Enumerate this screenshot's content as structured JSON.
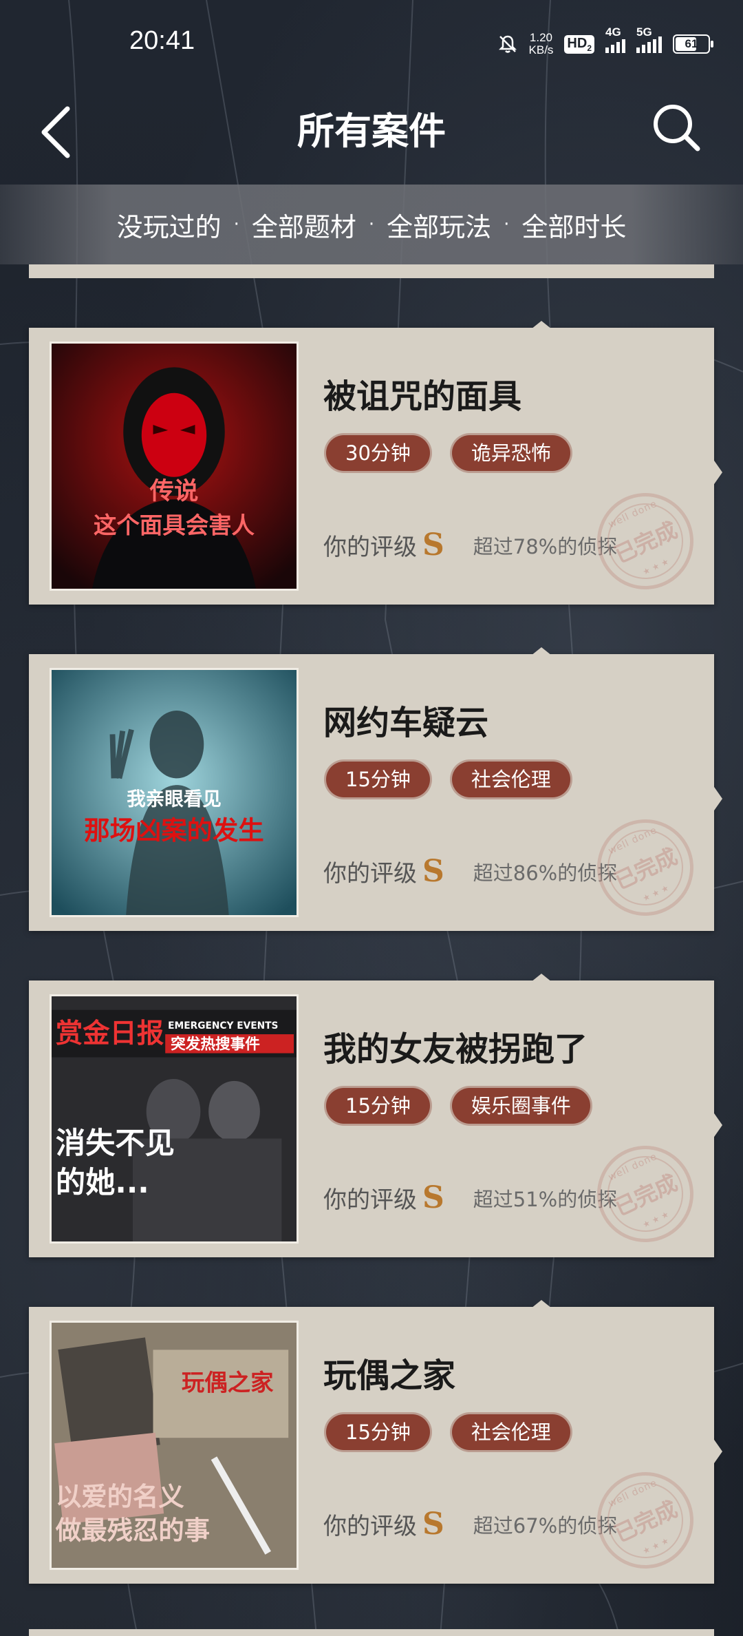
{
  "status_bar": {
    "time": "20:41",
    "net_speed_value": "1.20",
    "net_speed_unit": "KB/s",
    "hd_badge": "HD",
    "hd_sub": "2",
    "sig1_label": "4G",
    "sig2_label": "5G",
    "battery": "61",
    "icons": [
      "mute-bell-icon",
      "signal-icon",
      "battery-icon"
    ]
  },
  "nav": {
    "title": "所有案件",
    "back_icon": "chevron-left-icon",
    "search_icon": "search-icon"
  },
  "filters": {
    "items": [
      "没玩过的",
      "全部题材",
      "全部玩法",
      "全部时长"
    ],
    "separator": "·"
  },
  "cases": [
    {
      "title": "被诅咒的面具",
      "tags": [
        "30分钟",
        "诡异恐怖"
      ],
      "rating_label": "你的评级",
      "rating_grade": "S",
      "percentile": "超过78%的侦探",
      "stamp_text": "已完成",
      "stamp_small": "well done",
      "cover_text": [
        "传说",
        "这个面具会害人"
      ]
    },
    {
      "title": "网约车疑云",
      "tags": [
        "15分钟",
        "社会伦理"
      ],
      "rating_label": "你的评级",
      "rating_grade": "S",
      "percentile": "超过86%的侦探",
      "stamp_text": "已完成",
      "stamp_small": "well done",
      "cover_text": [
        "我亲眼看见",
        "那场凶案的发生"
      ]
    },
    {
      "title": "我的女友被拐跑了",
      "tags": [
        "15分钟",
        "娱乐圈事件"
      ],
      "rating_label": "你的评级",
      "rating_grade": "S",
      "percentile": "超过51%的侦探",
      "stamp_text": "已完成",
      "stamp_small": "well done",
      "cover_text": [
        "赏金日报",
        "EMERGENCY EVENTS",
        "突发热搜事件",
        "消失不见",
        "的她..."
      ]
    },
    {
      "title": "玩偶之家",
      "tags": [
        "15分钟",
        "社会伦理"
      ],
      "rating_label": "你的评级",
      "rating_grade": "S",
      "percentile": "超过67%的侦探",
      "stamp_text": "已完成",
      "stamp_small": "well done",
      "cover_text": [
        "玩偶之家",
        "以爱的名义",
        "做最残忍的事"
      ]
    }
  ],
  "colors": {
    "background": "#1c2129",
    "card": "#d6d0c5",
    "tag": "#8a3f31",
    "grade": "#b8782e"
  }
}
